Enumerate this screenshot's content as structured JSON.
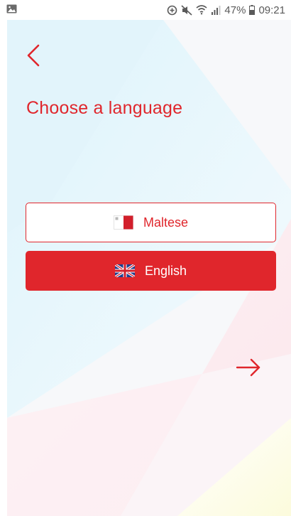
{
  "status_bar": {
    "battery_percent": "47%",
    "time": "09:21",
    "icons": [
      "image-icon",
      "data-saver-icon",
      "mute-icon",
      "wifi-icon",
      "signal-icon",
      "battery-icon"
    ]
  },
  "header": {
    "back_icon": "chevron-left-icon",
    "title": "Choose a language"
  },
  "languages": [
    {
      "label": "Maltese",
      "flag": "malta-flag-icon",
      "selected": false
    },
    {
      "label": "English",
      "flag": "uk-flag-icon",
      "selected": true
    }
  ],
  "footer": {
    "next_icon": "arrow-right-icon"
  },
  "colors": {
    "accent": "#e0262c",
    "background": "#ffffff"
  }
}
